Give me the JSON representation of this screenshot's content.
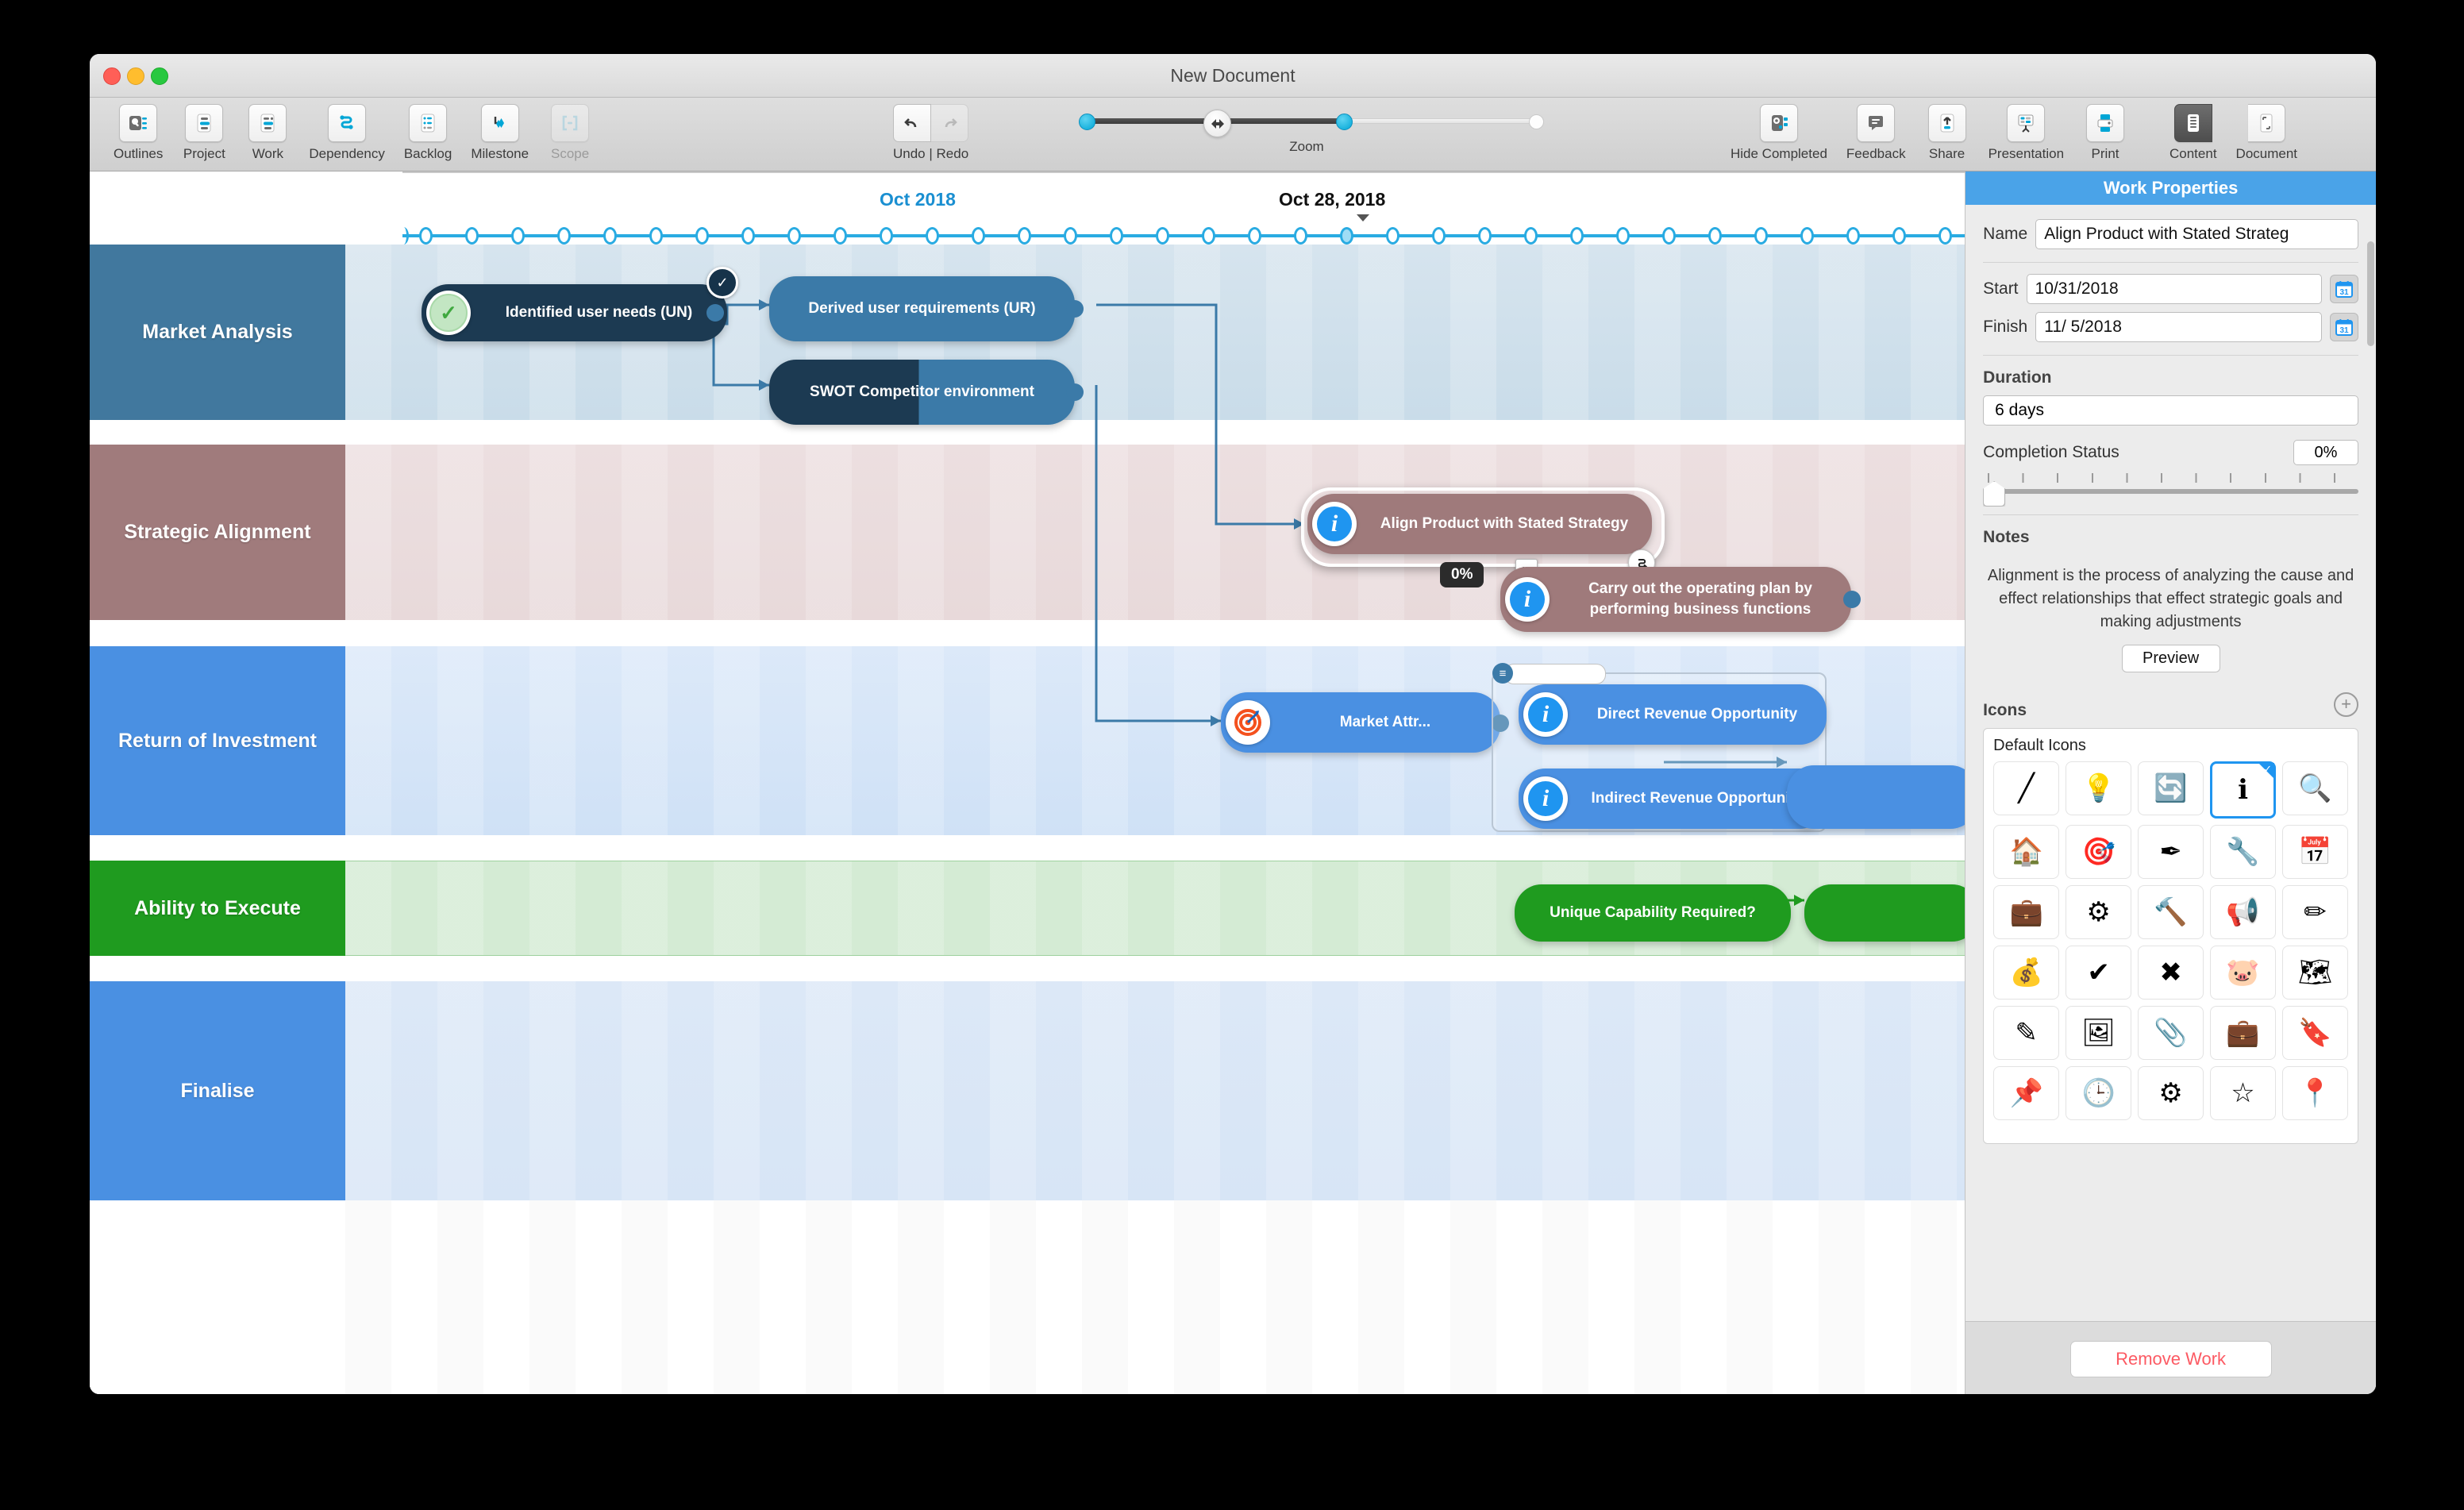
{
  "window": {
    "title": "New Document"
  },
  "toolbar": {
    "left_items": [
      {
        "label": "Outlines",
        "icon": "outlines-icon",
        "disabled": false
      },
      {
        "label": "Project",
        "icon": "project-icon",
        "disabled": false
      },
      {
        "label": "Work",
        "icon": "work-icon",
        "disabled": false
      },
      {
        "label": "Dependency",
        "icon": "dependency-icon",
        "disabled": false
      },
      {
        "label": "Backlog",
        "icon": "backlog-icon",
        "disabled": false
      },
      {
        "label": "Milestone",
        "icon": "milestone-icon",
        "disabled": false
      },
      {
        "label": "Scope",
        "icon": "scope-icon",
        "disabled": true
      }
    ],
    "undo_redo_label": "Undo | Redo",
    "zoom_label": "Zoom",
    "right_items": [
      {
        "label": "Hide Completed",
        "icon": "hide-completed-icon"
      },
      {
        "label": "Feedback",
        "icon": "feedback-icon"
      },
      {
        "label": "Share",
        "icon": "share-icon"
      },
      {
        "label": "Presentation",
        "icon": "presentation-icon"
      },
      {
        "label": "Print",
        "icon": "print-icon"
      }
    ],
    "segmented": [
      {
        "label": "Content",
        "icon": "content-icon",
        "selected": true
      },
      {
        "label": "Document",
        "icon": "document-icon",
        "selected": false
      }
    ]
  },
  "timeline": {
    "month_label": "Oct 2018",
    "today_label": "Oct 28, 2018",
    "marker_count": 36,
    "selected_marker_index": 20
  },
  "lanes": [
    {
      "name": "Market Analysis",
      "color": "#41789E",
      "band": "#cfe0ea"
    },
    {
      "name": "Strategic Alignment",
      "color": "#A07B7C",
      "band": "#ecdedf"
    },
    {
      "name": "Return of Investment",
      "color": "#4A90E2",
      "band": "#d9e7f8"
    },
    {
      "name": "Ability to Execute",
      "color": "#1F9B1F",
      "band": "#d4ebd4"
    },
    {
      "name": "Finalise",
      "color": "#4A90E2",
      "band": "#dbe8f7"
    }
  ],
  "nodes": {
    "identified_user_needs": "Identified user needs (UN)",
    "derived_user_requirements": "Derived user requirements (UR)",
    "swot": "SWOT Competitor environment",
    "align_product": "Align Product with Stated Strategy",
    "carry_out": "Carry out the operating plan by performing business functions",
    "market_attr": "Market Attr...",
    "direct_revenue": "Direct Revenue Opportunity",
    "indirect_revenue": "Indirect Revenue Opportunity",
    "unique_capability": "Unique Capability Required?"
  },
  "canvas_overlay": {
    "percent_pill": "0%"
  },
  "panel": {
    "title": "Work Properties",
    "name_label": "Name",
    "name_value": "Align Product with Stated Strateg",
    "start_label": "Start",
    "start_value": "10/31/2018",
    "finish_label": "Finish",
    "finish_value": "11/  5/2018",
    "duration_label": "Duration",
    "duration_value": "6 days",
    "completion_label": "Completion Status",
    "completion_value": "0%",
    "notes_label": "Notes",
    "notes_text": "Alignment is the process of analyzing the cause and effect relationships that effect strategic goals and making adjustments",
    "preview_label": "Preview",
    "icons_label": "Icons",
    "add_icon_label": "+",
    "default_icons_label": "Default Icons",
    "remove_label": "Remove Work",
    "calendar_icon_day": "31",
    "icon_items": [
      {
        "name": "none-icon",
        "glyph": "╱",
        "selected": false
      },
      {
        "name": "lightbulb-icon",
        "glyph": "💡",
        "selected": false
      },
      {
        "name": "refresh-icon",
        "glyph": "🔄",
        "selected": false
      },
      {
        "name": "info-icon",
        "glyph": "ℹ",
        "selected": true
      },
      {
        "name": "magnifier-icon",
        "glyph": "🔍",
        "selected": false
      },
      {
        "name": "house-icon",
        "glyph": "🏠",
        "selected": false
      },
      {
        "name": "target-icon",
        "glyph": "🎯",
        "selected": false
      },
      {
        "name": "ruler-pencil-icon",
        "glyph": "✒",
        "selected": false
      },
      {
        "name": "wrench-icon",
        "glyph": "🔧",
        "selected": false
      },
      {
        "name": "deadline-calendar-icon",
        "glyph": "📅",
        "selected": false
      },
      {
        "name": "briefcase-icon",
        "glyph": "💼",
        "selected": false
      },
      {
        "name": "gear-icon",
        "glyph": "⚙",
        "selected": false
      },
      {
        "name": "hammer-icon",
        "glyph": "🔨",
        "selected": false
      },
      {
        "name": "megaphone-icon",
        "glyph": "📢",
        "selected": false
      },
      {
        "name": "highlighter-icon",
        "glyph": "✏",
        "selected": false
      },
      {
        "name": "coins-icon",
        "glyph": "💰",
        "selected": false
      },
      {
        "name": "check-circle-icon",
        "glyph": "✔",
        "selected": false
      },
      {
        "name": "error-circle-icon",
        "glyph": "✖",
        "selected": false
      },
      {
        "name": "piggy-bank-icon",
        "glyph": "🐷",
        "selected": false
      },
      {
        "name": "map-edit-icon",
        "glyph": "🗺",
        "selected": false
      },
      {
        "name": "pencil-icon",
        "glyph": "✎",
        "selected": false
      },
      {
        "name": "image-icon",
        "glyph": "🖼",
        "selected": false
      },
      {
        "name": "binder-clip-icon",
        "glyph": "📎",
        "selected": false
      },
      {
        "name": "suitcase-icon",
        "glyph": "💼",
        "selected": false
      },
      {
        "name": "bookmark-icon",
        "glyph": "🔖",
        "selected": false
      },
      {
        "name": "pushpin-icon",
        "glyph": "📌",
        "selected": false
      },
      {
        "name": "clock-icon",
        "glyph": "🕒",
        "selected": false
      },
      {
        "name": "gears-icon",
        "glyph": "⚙",
        "selected": false
      },
      {
        "name": "star-icon",
        "glyph": "☆",
        "selected": false
      },
      {
        "name": "location-pin-icon",
        "glyph": "📍",
        "selected": false
      }
    ]
  }
}
